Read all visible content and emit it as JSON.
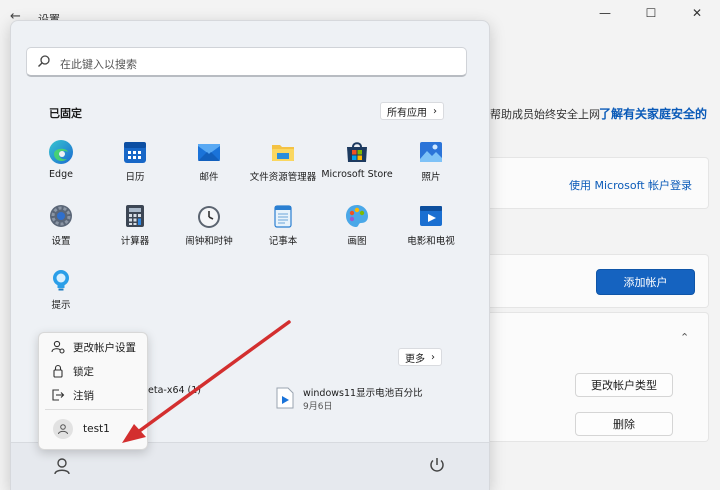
{
  "settings": {
    "title": "设置",
    "controls": {
      "minimize": "—",
      "maximize": "☐",
      "close": "✕"
    },
    "family_text": "帮助成员始终安全上网",
    "family_link": "了解有关家庭安全的",
    "ms_login": "使用 Microsoft 帐户登录",
    "add_account": "添加帐户",
    "change_type": "更改帐户类型",
    "delete": "删除"
  },
  "start_menu": {
    "search_placeholder": "在此键入以搜索",
    "pinned_title": "已固定",
    "all_apps": "所有应用",
    "more": "更多",
    "pinned_apps": [
      {
        "label": "Edge",
        "icon": "edge-icon"
      },
      {
        "label": "日历",
        "icon": "calendar-icon"
      },
      {
        "label": "邮件",
        "icon": "mail-icon"
      },
      {
        "label": "文件资源管理器",
        "icon": "folder-icon"
      },
      {
        "label": "Microsoft Store",
        "icon": "store-icon"
      },
      {
        "label": "照片",
        "icon": "photos-icon"
      },
      {
        "label": "设置",
        "icon": "settings-icon"
      },
      {
        "label": "计算器",
        "icon": "calculator-icon"
      },
      {
        "label": "闹钟和时钟",
        "icon": "clock-icon"
      },
      {
        "label": "记事本",
        "icon": "notepad-icon"
      },
      {
        "label": "画图",
        "icon": "paint-icon"
      },
      {
        "label": "电影和电视",
        "icon": "movies-icon"
      },
      {
        "label": "提示",
        "icon": "tips-icon"
      }
    ],
    "recommended": {
      "partial_name": "eta-x64 (1)",
      "item_name": "windows11显示电池百分比",
      "item_date": "9月6日"
    }
  },
  "user_popup": {
    "items": [
      "更改帐户设置",
      "锁定",
      "注销"
    ],
    "username": "test1"
  },
  "colors": {
    "accent": "#1563c0",
    "link": "#0a5ab8",
    "arrow": "#d32f2f"
  }
}
